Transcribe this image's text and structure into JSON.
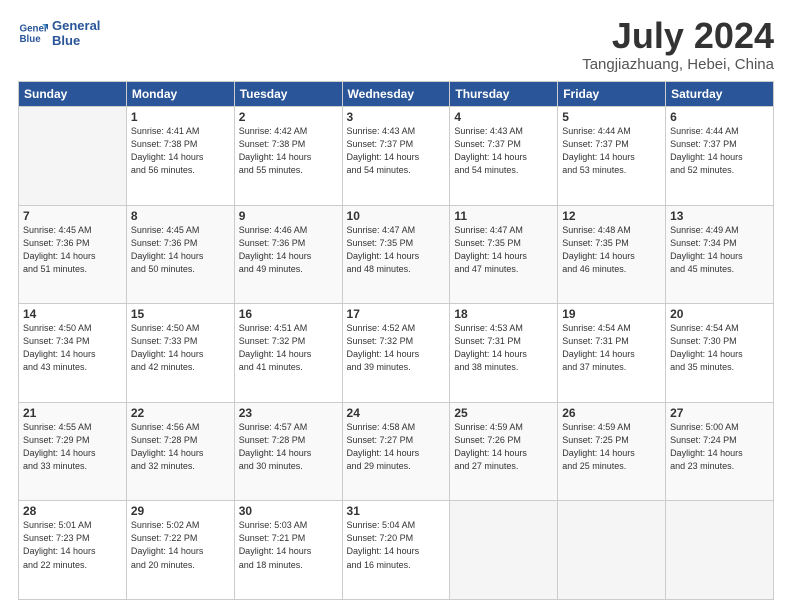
{
  "logo": {
    "line1": "General",
    "line2": "Blue"
  },
  "title": "July 2024",
  "subtitle": "Tangjiazhuang, Hebei, China",
  "days_header": [
    "Sunday",
    "Monday",
    "Tuesday",
    "Wednesday",
    "Thursday",
    "Friday",
    "Saturday"
  ],
  "weeks": [
    [
      {
        "day": "",
        "info": ""
      },
      {
        "day": "1",
        "info": "Sunrise: 4:41 AM\nSunset: 7:38 PM\nDaylight: 14 hours\nand 56 minutes."
      },
      {
        "day": "2",
        "info": "Sunrise: 4:42 AM\nSunset: 7:38 PM\nDaylight: 14 hours\nand 55 minutes."
      },
      {
        "day": "3",
        "info": "Sunrise: 4:43 AM\nSunset: 7:37 PM\nDaylight: 14 hours\nand 54 minutes."
      },
      {
        "day": "4",
        "info": "Sunrise: 4:43 AM\nSunset: 7:37 PM\nDaylight: 14 hours\nand 54 minutes."
      },
      {
        "day": "5",
        "info": "Sunrise: 4:44 AM\nSunset: 7:37 PM\nDaylight: 14 hours\nand 53 minutes."
      },
      {
        "day": "6",
        "info": "Sunrise: 4:44 AM\nSunset: 7:37 PM\nDaylight: 14 hours\nand 52 minutes."
      }
    ],
    [
      {
        "day": "7",
        "info": "Sunrise: 4:45 AM\nSunset: 7:36 PM\nDaylight: 14 hours\nand 51 minutes."
      },
      {
        "day": "8",
        "info": "Sunrise: 4:45 AM\nSunset: 7:36 PM\nDaylight: 14 hours\nand 50 minutes."
      },
      {
        "day": "9",
        "info": "Sunrise: 4:46 AM\nSunset: 7:36 PM\nDaylight: 14 hours\nand 49 minutes."
      },
      {
        "day": "10",
        "info": "Sunrise: 4:47 AM\nSunset: 7:35 PM\nDaylight: 14 hours\nand 48 minutes."
      },
      {
        "day": "11",
        "info": "Sunrise: 4:47 AM\nSunset: 7:35 PM\nDaylight: 14 hours\nand 47 minutes."
      },
      {
        "day": "12",
        "info": "Sunrise: 4:48 AM\nSunset: 7:35 PM\nDaylight: 14 hours\nand 46 minutes."
      },
      {
        "day": "13",
        "info": "Sunrise: 4:49 AM\nSunset: 7:34 PM\nDaylight: 14 hours\nand 45 minutes."
      }
    ],
    [
      {
        "day": "14",
        "info": "Sunrise: 4:50 AM\nSunset: 7:34 PM\nDaylight: 14 hours\nand 43 minutes."
      },
      {
        "day": "15",
        "info": "Sunrise: 4:50 AM\nSunset: 7:33 PM\nDaylight: 14 hours\nand 42 minutes."
      },
      {
        "day": "16",
        "info": "Sunrise: 4:51 AM\nSunset: 7:32 PM\nDaylight: 14 hours\nand 41 minutes."
      },
      {
        "day": "17",
        "info": "Sunrise: 4:52 AM\nSunset: 7:32 PM\nDaylight: 14 hours\nand 39 minutes."
      },
      {
        "day": "18",
        "info": "Sunrise: 4:53 AM\nSunset: 7:31 PM\nDaylight: 14 hours\nand 38 minutes."
      },
      {
        "day": "19",
        "info": "Sunrise: 4:54 AM\nSunset: 7:31 PM\nDaylight: 14 hours\nand 37 minutes."
      },
      {
        "day": "20",
        "info": "Sunrise: 4:54 AM\nSunset: 7:30 PM\nDaylight: 14 hours\nand 35 minutes."
      }
    ],
    [
      {
        "day": "21",
        "info": "Sunrise: 4:55 AM\nSunset: 7:29 PM\nDaylight: 14 hours\nand 33 minutes."
      },
      {
        "day": "22",
        "info": "Sunrise: 4:56 AM\nSunset: 7:28 PM\nDaylight: 14 hours\nand 32 minutes."
      },
      {
        "day": "23",
        "info": "Sunrise: 4:57 AM\nSunset: 7:28 PM\nDaylight: 14 hours\nand 30 minutes."
      },
      {
        "day": "24",
        "info": "Sunrise: 4:58 AM\nSunset: 7:27 PM\nDaylight: 14 hours\nand 29 minutes."
      },
      {
        "day": "25",
        "info": "Sunrise: 4:59 AM\nSunset: 7:26 PM\nDaylight: 14 hours\nand 27 minutes."
      },
      {
        "day": "26",
        "info": "Sunrise: 4:59 AM\nSunset: 7:25 PM\nDaylight: 14 hours\nand 25 minutes."
      },
      {
        "day": "27",
        "info": "Sunrise: 5:00 AM\nSunset: 7:24 PM\nDaylight: 14 hours\nand 23 minutes."
      }
    ],
    [
      {
        "day": "28",
        "info": "Sunrise: 5:01 AM\nSunset: 7:23 PM\nDaylight: 14 hours\nand 22 minutes."
      },
      {
        "day": "29",
        "info": "Sunrise: 5:02 AM\nSunset: 7:22 PM\nDaylight: 14 hours\nand 20 minutes."
      },
      {
        "day": "30",
        "info": "Sunrise: 5:03 AM\nSunset: 7:21 PM\nDaylight: 14 hours\nand 18 minutes."
      },
      {
        "day": "31",
        "info": "Sunrise: 5:04 AM\nSunset: 7:20 PM\nDaylight: 14 hours\nand 16 minutes."
      },
      {
        "day": "",
        "info": ""
      },
      {
        "day": "",
        "info": ""
      },
      {
        "day": "",
        "info": ""
      }
    ]
  ]
}
